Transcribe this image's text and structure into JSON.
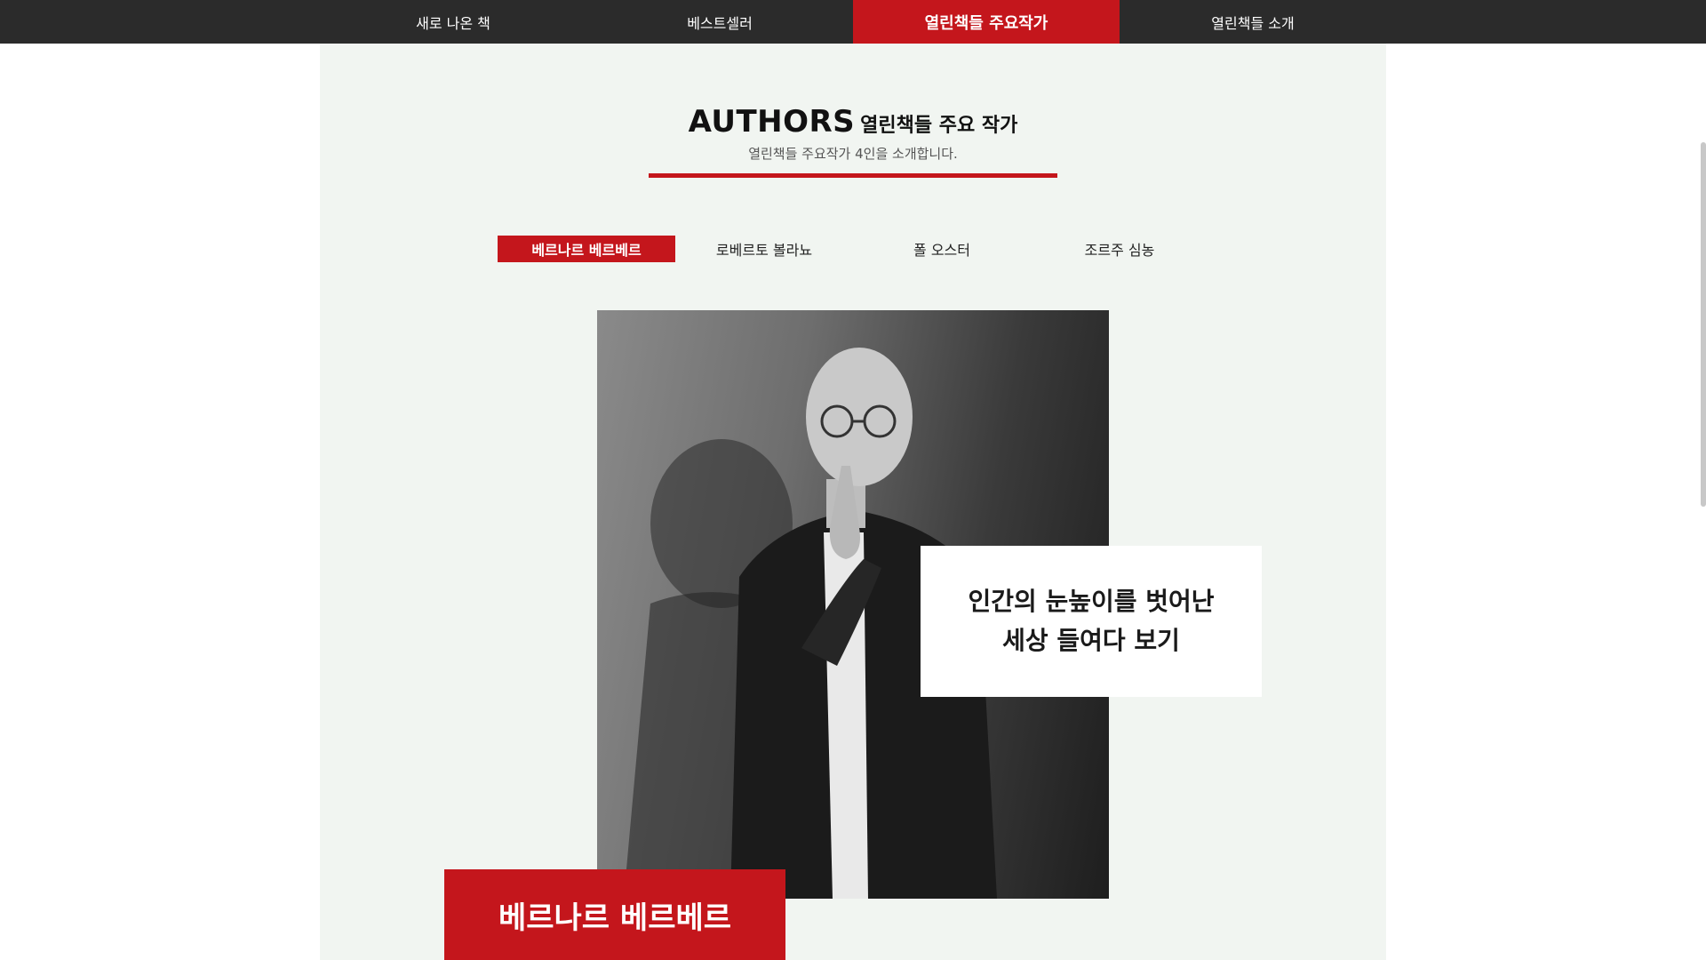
{
  "nav": {
    "items": [
      {
        "label": "새로 나온 책"
      },
      {
        "label": "베스트셀러"
      },
      {
        "label": "열린책들 주요작가"
      },
      {
        "label": "열린책들 소개"
      }
    ],
    "active_index": 2
  },
  "section": {
    "title_en": "AUTHORS",
    "title_ko": "열린책들 주요 작가",
    "subtitle": "열린책들 주요작가 4인을 소개합니다."
  },
  "author_tabs": {
    "items": [
      {
        "label": "베르나르 베르베르"
      },
      {
        "label": "로베르토 볼라뇨"
      },
      {
        "label": "폴 오스터"
      },
      {
        "label": "조르주 심농"
      }
    ],
    "active_index": 0
  },
  "featured": {
    "quote_line1": "인간의 눈높이를 벗어난",
    "quote_line2": "세상 들여다 보기",
    "name": "베르나르 베르베르",
    "photo": "author-portrait-image"
  },
  "colors": {
    "accent": "#c4161c",
    "nav_bg": "#2b2b2b",
    "content_bg": "#f1f5f1"
  }
}
